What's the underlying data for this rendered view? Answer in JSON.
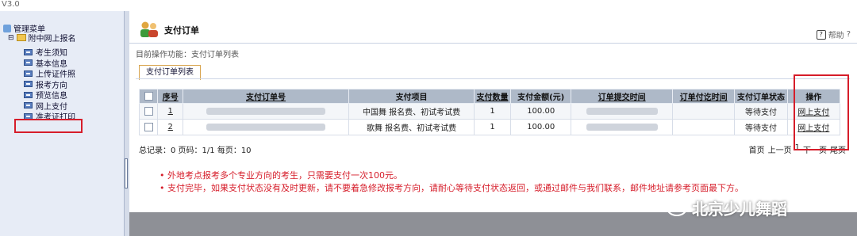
{
  "version": "V3.0",
  "sidebar": {
    "root_label": "管理菜单",
    "group_label": "附中网上报名",
    "items": [
      {
        "label": "考生须知"
      },
      {
        "label": "基本信息"
      },
      {
        "label": "上传证件照"
      },
      {
        "label": "报考方向"
      },
      {
        "label": "预览信息"
      },
      {
        "label": "网上支付"
      },
      {
        "label": "准考证打印"
      }
    ]
  },
  "header": {
    "title": "支付订单",
    "help_label": "帮助",
    "help_icon": "?",
    "help_suffix": "?"
  },
  "breadcrumb": "目前操作功能：支付订单列表",
  "tab_label": "支付订单列表",
  "table": {
    "columns": [
      "序号",
      "支付订单号",
      "支付项目",
      "支付数量",
      "支付金额(元)",
      "订单提交时间",
      "订单付讫时间",
      "支付订单状态",
      "操作"
    ],
    "rows": [
      {
        "index": "1",
        "project": "中国舞 报名费、初试考试费",
        "quantity": "1",
        "amount": "100.00",
        "status": "等待支付",
        "action": "网上支付"
      },
      {
        "index": "2",
        "project": "歌舞 报名费、初试考试费",
        "quantity": "1",
        "amount": "100.00",
        "status": "等待支付",
        "action": "网上支付"
      }
    ]
  },
  "summary": "总记录：0 页码：1/1 每页：10",
  "pager": {
    "first": "首页",
    "prev": "上一页",
    "current": "1",
    "next": "下一页",
    "last": "尾页"
  },
  "notes": [
    "外地考点报考多个专业方向的考生，只需要支付一次100元。",
    "支付完毕，如果支付状态没有及时更新，请不要着急修改报考方向，请耐心等待支付状态返回，或通过邮件与我们联系，邮件地址请参考页面最下方。"
  ],
  "watermark": "北京少儿舞蹈",
  "colors": {
    "highlight": "#d61d2a",
    "header_bg": "#aeb9c8",
    "sidebar_bg": "#e7ecf6"
  }
}
